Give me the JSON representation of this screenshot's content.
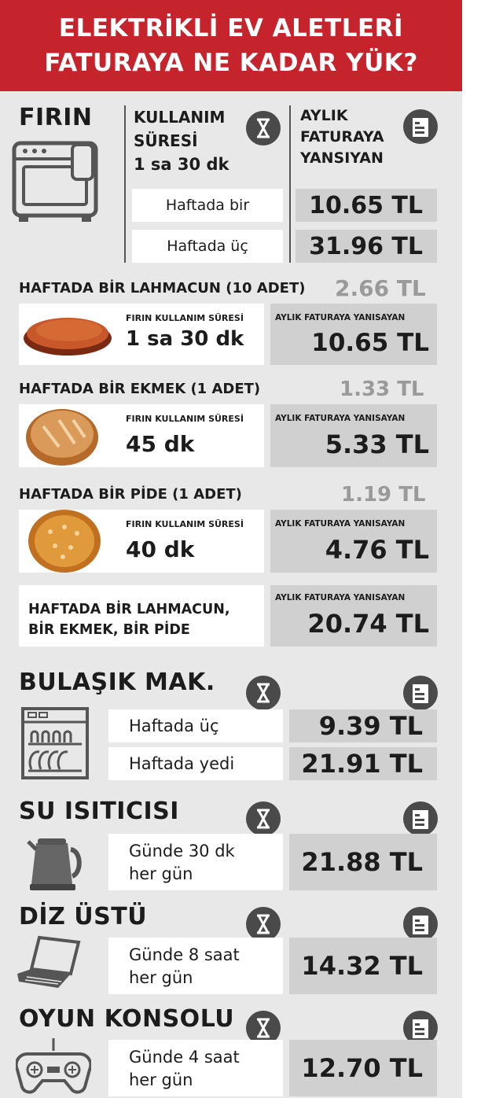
{
  "header": {
    "line1": "ELEKTRİKLİ EV ALETLERİ",
    "line2": "FATURAYA NE KADAR YÜK?"
  },
  "firin": {
    "title": "FIRIN",
    "usage_label_1": "KULLANIM",
    "usage_label_2": "SÜRESİ",
    "usage_value": "1 sa 30 dk",
    "bill_label_1": "AYLIK",
    "bill_label_2": "FATURAYA",
    "bill_label_3": "YANSIYAN",
    "rows": [
      {
        "label": "Haftada bir",
        "value": "10.65 TL"
      },
      {
        "label": "Haftada üç",
        "value": "31.96 TL"
      }
    ]
  },
  "foods": [
    {
      "title": "HAFTADA BİR LAHMACUN (10 ADET)",
      "weekly": "2.66 TL",
      "usage_label": "FIRIN KULLANIM SÜRESİ",
      "usage": "1 sa 30 dk",
      "bill_label": "AYLIK FATURAYA YANISAYAN",
      "bill": "10.65 TL"
    },
    {
      "title": "HAFTADA BİR EKMEK (1 ADET)",
      "weekly": "1.33 TL",
      "usage_label": "FIRIN KULLANIM SÜRESİ",
      "usage": "45 dk",
      "bill_label": "AYLIK FATURAYA YANISAYAN",
      "bill": "5.33 TL"
    },
    {
      "title": "HAFTADA BİR PİDE (1 ADET)",
      "weekly": "1.19 TL",
      "usage_label": "FIRIN KULLANIM SÜRESİ",
      "usage": "40 dk",
      "bill_label": "AYLIK FATURAYA YANISAYAN",
      "bill": "4.76 TL"
    }
  ],
  "combo": {
    "line1": "HAFTADA BİR LAHMACUN,",
    "line2": "BİR EKMEK, BİR PİDE",
    "bill_label": "AYLIK FATURAYA YANISAYAN",
    "bill": "20.74 TL"
  },
  "bulasik": {
    "title": "BULAŞIK MAK.",
    "rows": [
      {
        "label": "Haftada üç",
        "value": "9.39 TL"
      },
      {
        "label": "Haftada yedi",
        "value": "21.91 TL"
      }
    ]
  },
  "su": {
    "title": "SU ISITICISI",
    "line1": "Günde 30 dk",
    "line2": "her gün",
    "value": "21.88 TL"
  },
  "diz": {
    "title": "DİZ ÜSTÜ",
    "line1": "Günde 8 saat",
    "line2": "her gün",
    "value": "14.32 TL"
  },
  "oyun": {
    "title": "OYUN KONSOLU",
    "line1": "Günde 4 saat",
    "line2": "her gün",
    "value": "12.70 TL"
  },
  "icons": {
    "timer": "hourglass-icon",
    "bill": "invoice-icon",
    "oven": "oven-icon",
    "dishwasher": "dishwasher-icon",
    "kettle": "kettle-icon",
    "laptop": "laptop-icon",
    "gamepad": "gamepad-icon"
  },
  "colors": {
    "header": "#c5242c",
    "panel": "#e8e8e8",
    "value_box": "#d0d0d0",
    "icon": "#4a4a4a"
  }
}
